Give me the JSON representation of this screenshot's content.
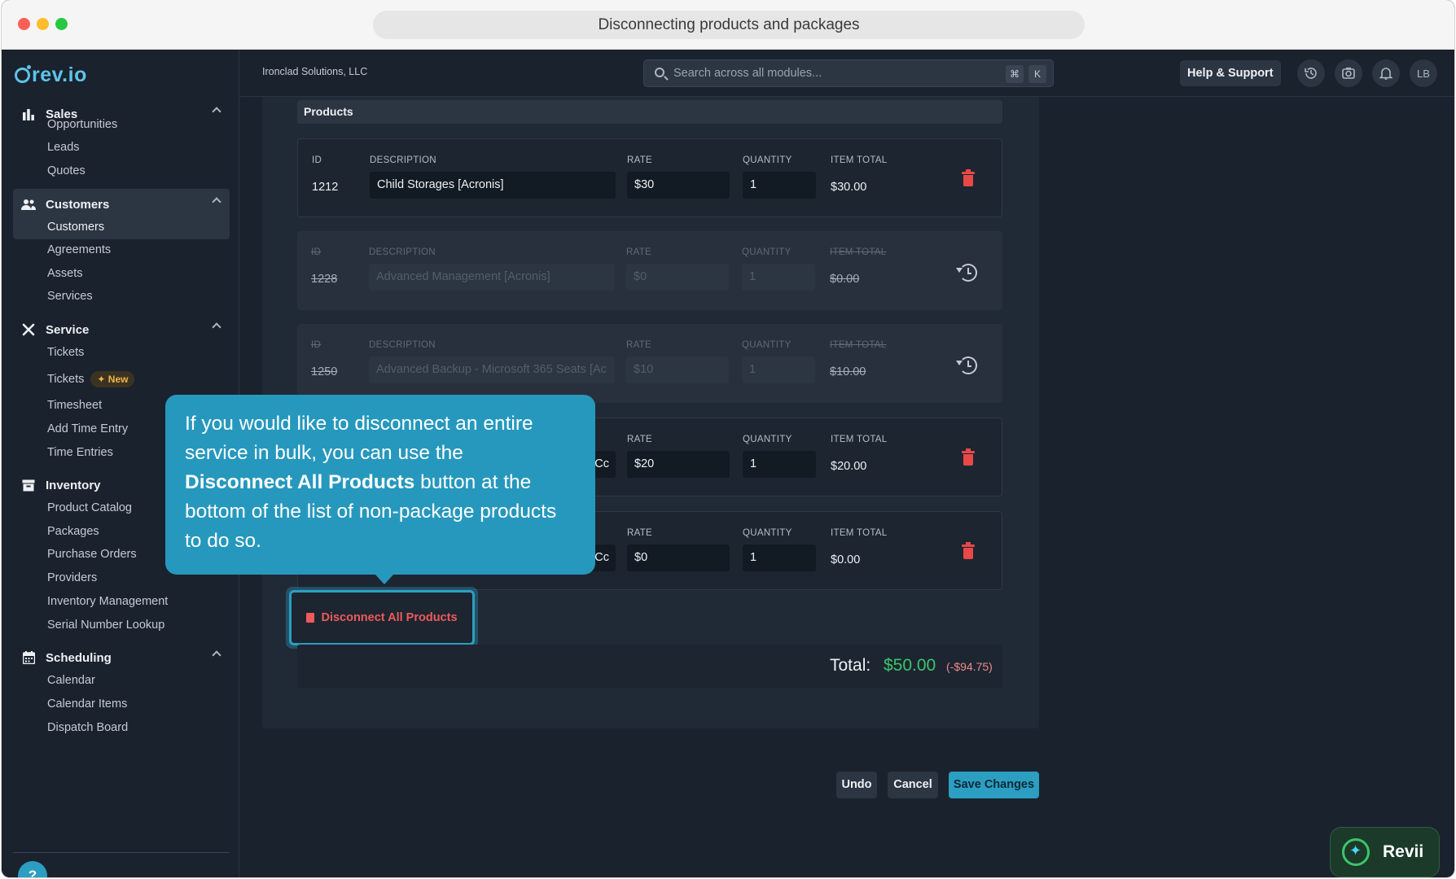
{
  "window": {
    "title": "Disconnecting products and packages"
  },
  "brand": {
    "name": "rev.io",
    "accent": "#2b9ec2"
  },
  "topbar": {
    "company": "Ironclad Solutions, LLC",
    "search_placeholder": "Search across all modules...",
    "kbd_cmd": "⌘",
    "kbd_k": "K",
    "help_label": "Help & Support",
    "avatar_initials": "LB"
  },
  "sidebar": {
    "sales": {
      "label": "Sales",
      "items": [
        "Opportunities",
        "Leads",
        "Quotes"
      ]
    },
    "customers": {
      "label": "Customers",
      "items": [
        "Customers",
        "Agreements",
        "Assets",
        "Services"
      ]
    },
    "service": {
      "label": "Service",
      "items": [
        "Tickets",
        "Tickets",
        "Timesheet",
        "Add Time Entry",
        "Time Entries"
      ],
      "new_badge": "New"
    },
    "inventory": {
      "label": "Inventory",
      "items": [
        "Product Catalog",
        "Packages",
        "Purchase Orders",
        "Providers",
        "Inventory Management",
        "Serial Number Lookup"
      ]
    },
    "scheduling": {
      "label": "Scheduling",
      "items": [
        "Calendar",
        "Calendar Items",
        "Dispatch Board"
      ]
    },
    "help_glyph": "?"
  },
  "products": {
    "header": "Products",
    "columns": {
      "id": "ID",
      "description": "DESCRIPTION",
      "rate": "RATE",
      "quantity": "QUANTITY",
      "item_total": "ITEM TOTAL"
    },
    "rows": [
      {
        "id": "1212",
        "description": "Child Storages [Acronis]",
        "rate": "$30",
        "quantity": "1",
        "item_total": "$30.00",
        "state": "active"
      },
      {
        "id": "1228",
        "description": "Advanced Management [Acronis]",
        "rate": "$0",
        "quantity": "1",
        "item_total": "$0.00",
        "state": "removed"
      },
      {
        "id": "1250",
        "description": "Advanced Backup - Microsoft 365 Seats [Ac",
        "rate": "$10",
        "quantity": "1",
        "item_total": "$10.00",
        "state": "removed"
      },
      {
        "id": "",
        "description": "Cc",
        "rate": "$20",
        "quantity": "1",
        "item_total": "$20.00",
        "state": "active"
      },
      {
        "id": "",
        "description": "Cc",
        "rate": "$0",
        "quantity": "1",
        "item_total": "$0.00",
        "state": "active"
      }
    ],
    "disconnect_all_label": "Disconnect All Products",
    "total_label": "Total:",
    "total_value": "$50.00",
    "total_diff": "(-$94.75)"
  },
  "actions": {
    "undo": "Undo",
    "cancel": "Cancel",
    "save": "Save Changes"
  },
  "tooltip": {
    "text_before": "If you would like to disconnect an entire service in bulk, you can use the ",
    "bold": "Disconnect All Products",
    "text_after": " button at the bottom of the list of non-package products to do so."
  },
  "assistant": {
    "label": "Revii"
  }
}
